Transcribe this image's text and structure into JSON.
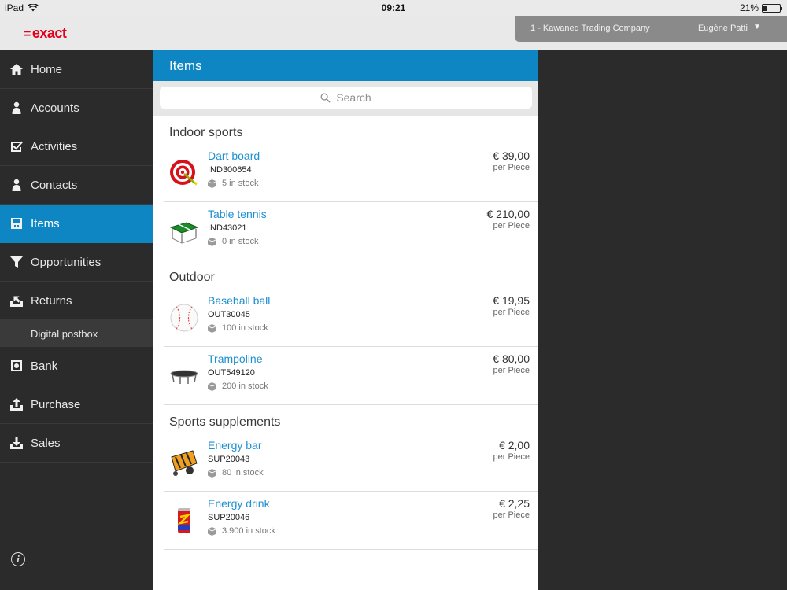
{
  "status_bar": {
    "device": "iPad",
    "time": "09:21",
    "battery": "21%",
    "battery_level": 0.21
  },
  "header": {
    "logo": "exact",
    "company": "1 - Kawaned Trading Company",
    "user": "Eugène Patti"
  },
  "sidebar": {
    "items": [
      {
        "label": "Home",
        "icon": "home-icon"
      },
      {
        "label": "Accounts",
        "icon": "person-icon"
      },
      {
        "label": "Activities",
        "icon": "checkbox-icon"
      },
      {
        "label": "Contacts",
        "icon": "person-icon"
      },
      {
        "label": "Items",
        "icon": "item-icon",
        "active": true
      },
      {
        "label": "Opportunities",
        "icon": "funnel-icon"
      },
      {
        "label": "Returns",
        "icon": "return-icon"
      }
    ],
    "subitem": "Digital postbox",
    "items2": [
      {
        "label": "Bank",
        "icon": "safe-icon"
      },
      {
        "label": "Purchase",
        "icon": "upload-icon"
      },
      {
        "label": "Sales",
        "icon": "download-icon"
      }
    ]
  },
  "panel": {
    "title": "Items",
    "search_placeholder": "Search",
    "sections": [
      {
        "title": "Indoor sports",
        "items": [
          {
            "name": "Dart board",
            "code": "IND300654",
            "stock": "5 in stock",
            "price": "€ 39,00",
            "unit": "per Piece",
            "thumb": "dartboard-icon"
          },
          {
            "name": "Table tennis",
            "code": "IND43021",
            "stock": "0 in stock",
            "price": "€ 210,00",
            "unit": "per Piece",
            "thumb": "table-tennis-icon"
          }
        ]
      },
      {
        "title": "Outdoor",
        "items": [
          {
            "name": "Baseball ball",
            "code": "OUT30045",
            "stock": "100 in stock",
            "price": "€ 19,95",
            "unit": "per Piece",
            "thumb": "baseball-icon"
          },
          {
            "name": "Trampoline",
            "code": "OUT549120",
            "stock": "200 in stock",
            "price": "€ 80,00",
            "unit": "per Piece",
            "thumb": "trampoline-icon"
          }
        ]
      },
      {
        "title": "Sports supplements",
        "items": [
          {
            "name": "Energy bar",
            "code": "SUP20043",
            "stock": "80 in stock",
            "price": "€ 2,00",
            "unit": "per Piece",
            "thumb": "energy-bar-icon"
          },
          {
            "name": "Energy drink",
            "code": "SUP20046",
            "stock": "3.900 in stock",
            "price": "€ 2,25",
            "unit": "per Piece",
            "thumb": "energy-drink-icon"
          }
        ]
      }
    ]
  },
  "colors": {
    "accent": "#0e86c4",
    "link": "#1e8fcf",
    "brand": "#e3001b",
    "sidebar": "#2b2b2b"
  }
}
